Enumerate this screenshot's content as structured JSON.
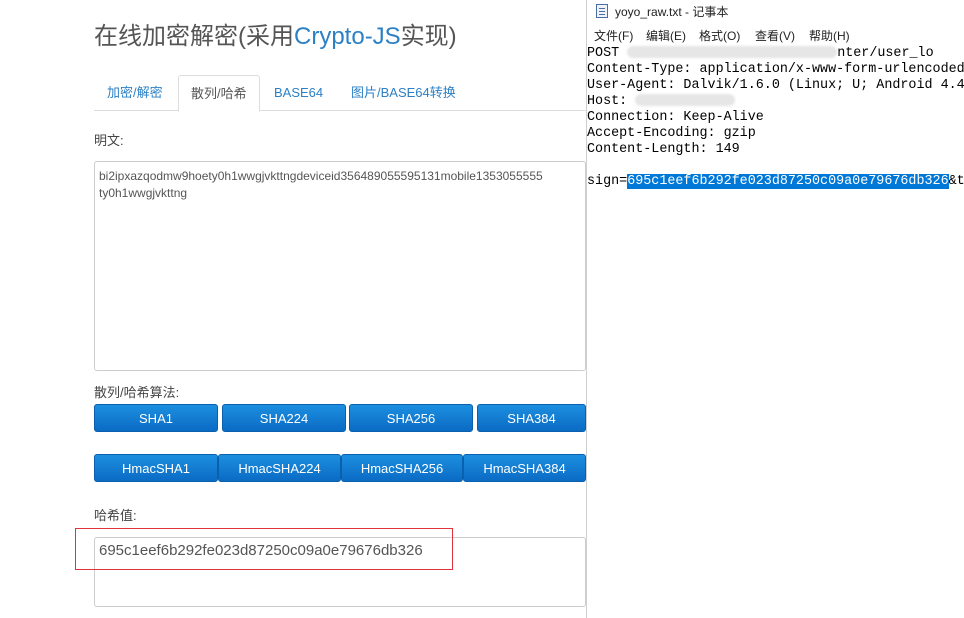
{
  "page": {
    "title_prefix": "在线加密解密(采用",
    "title_accent": "Crypto-JS",
    "title_suffix": "实现)"
  },
  "tabs": [
    {
      "label": "加密/解密"
    },
    {
      "label": "散列/哈希"
    },
    {
      "label": "BASE64"
    },
    {
      "label": "图片/BASE64转换"
    }
  ],
  "plaintext": {
    "label": "明文:",
    "lines": [
      "bi2ipxazqodmw9hoety0h1wwgjvkttngdeviceid356489055595131mobile1353055555",
      "ty0h1wwgjvkttng"
    ]
  },
  "hash_algos": {
    "label": "散列/哈希算法:",
    "buttons": [
      "SHA1",
      "SHA224",
      "SHA256",
      "SHA384"
    ],
    "hmac_buttons": [
      "HmacSHA1",
      "HmacSHA224",
      "HmacSHA256",
      "HmacSHA384"
    ]
  },
  "hash_value": {
    "label": "哈希值:",
    "value": "695c1eef6b292fe023d87250c09a0e79676db326"
  },
  "notepad": {
    "title": "yoyo_raw.txt - 记事本",
    "menus": [
      "文件(F)",
      "编辑(E)",
      "格式(O)",
      "查看(V)",
      "帮助(H)"
    ],
    "line_post_start": "POST ",
    "line_post_end": "nter/user_lo",
    "line_content_type": "Content-Type: application/x-www-form-urlencoded",
    "line_user_agent": "User-Agent: Dalvik/1.6.0 (Linux; U; Android 4.4.",
    "line_host": "Host:",
    "line_connection": "Connection: Keep-Alive",
    "line_encoding": "Accept-Encoding: gzip",
    "line_length": "Content-Length: 149",
    "sign_prefix": "sign=",
    "sign_value": "695c1eef6b292fe023d87250c09a0e79676db326",
    "sign_suffix": "&t"
  }
}
